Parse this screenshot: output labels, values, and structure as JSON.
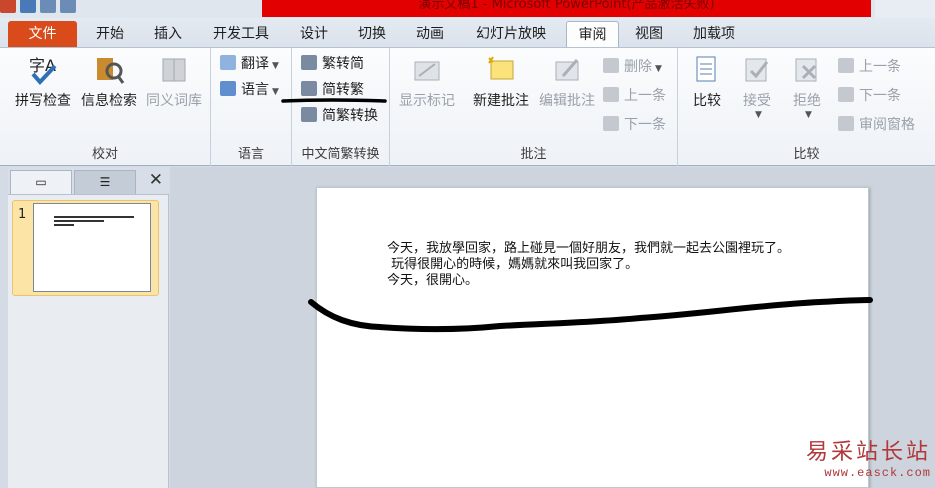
{
  "window": {
    "title": "演示文稿1 - Microsoft PowerPoint(产品激活失败)"
  },
  "tabs": [
    {
      "label": "文件"
    },
    {
      "label": "开始"
    },
    {
      "label": "插入"
    },
    {
      "label": "开发工具"
    },
    {
      "label": "设计"
    },
    {
      "label": "切换"
    },
    {
      "label": "动画"
    },
    {
      "label": "幻灯片放映"
    },
    {
      "label": "审阅"
    },
    {
      "label": "视图"
    },
    {
      "label": "加载项"
    }
  ],
  "groups": {
    "proofing": {
      "label": "校对",
      "spelling": "拼写检查",
      "research": "信息检索",
      "thesaurus": "同义词库"
    },
    "language": {
      "label": "语言",
      "translate": "翻译",
      "language": "语言"
    },
    "chinese": {
      "label": "中文简繁转换",
      "to_simplified": "繁转简",
      "to_traditional": "简转繁",
      "convert": "简繁转换"
    },
    "comments": {
      "label": "批注",
      "show_markup": "显示标记",
      "new_comment": "新建批注",
      "edit_comment": "编辑批注",
      "delete": "删除",
      "previous": "上一条",
      "next": "下一条"
    },
    "compare": {
      "label": "比较",
      "compare": "比较",
      "accept": "接受",
      "reject": "拒绝",
      "previous": "上一条",
      "next": "下一条",
      "reviewing_pane": "审阅窗格"
    }
  },
  "slides_pane": {
    "slide_number": "1",
    "close_glyph": "✕"
  },
  "slide": {
    "lines": [
      "今天，我放學回家，路上碰見一個好朋友，我們就一起去公園裡玩了。",
      " 玩得很開心的時候，媽媽就來叫我回家了。",
      "今天，很開心。"
    ]
  },
  "watermark": {
    "cn": "易采站长站",
    "url": "www.easck.com"
  },
  "colors": {
    "file_tab": "#d94b1b",
    "title_red": "#e30000",
    "ink": "#000000",
    "thumb_highlight": "#fbe4a6"
  }
}
